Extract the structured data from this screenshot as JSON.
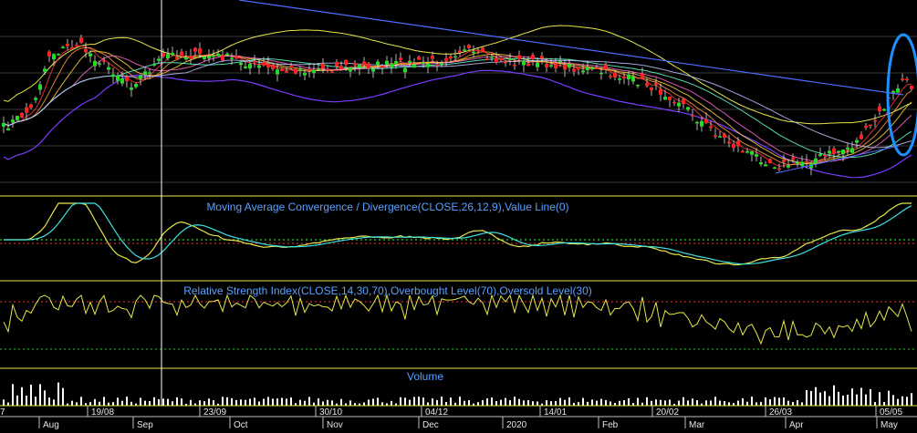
{
  "chart_data": [
    {
      "type": "line",
      "panel": "price",
      "title": "",
      "description_items": [
        "candlesticks",
        "moving-average ribbon",
        "bollinger-style envelope",
        "descending trendline",
        "highlight ellipse"
      ],
      "colors": {
        "bull": "#22dd22",
        "bear": "#ff2020",
        "envelope_upper": "#e6e64a",
        "envelope_lower": "#7a3cff",
        "trendline": "#4f6dff",
        "highlight": "#1e90ff",
        "ma_fast": "#ff3b3b",
        "ma_mid": "#ff9a3b",
        "ma_slow": "#ffd23b"
      }
    },
    {
      "type": "line",
      "panel": "macd",
      "title": "Moving Average Convergence / Divergence(CLOSE,26,12,9),Value Line(0)",
      "colors": {
        "macd": "#e6e64a",
        "signal": "#40e0e0",
        "zero": "#33ff33"
      }
    },
    {
      "type": "line",
      "panel": "rsi",
      "title": "Relative Strength Index(CLOSE,14,30,70),Overbought Level(70),Oversold Level(30)",
      "levels": {
        "overbought": 70,
        "oversold": 30
      },
      "colors": {
        "rsi": "#e6e64a",
        "overbought": "#ff3030",
        "oversold": "#22cc22"
      }
    },
    {
      "type": "bar",
      "panel": "volume",
      "title": "Volume",
      "colors": {
        "bar": "#ffffff"
      }
    }
  ],
  "x_axis": {
    "date_labels": [
      "19/08",
      "23/09",
      "30/10",
      "04/12",
      "14/01",
      "20/02",
      "26/03",
      "05/05"
    ],
    "month_labels": [
      "Aug",
      "Sep",
      "Oct",
      "Nov",
      "Dec",
      "2020",
      "Feb",
      "Mar",
      "Apr",
      "May"
    ],
    "left_edge_label": "7"
  }
}
